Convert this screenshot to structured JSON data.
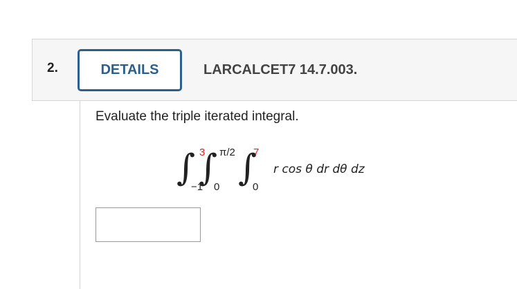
{
  "question": {
    "number": "2.",
    "details_label": "DETAILS",
    "problem_id": "LARCALCET7 14.7.003.",
    "prompt": "Evaluate the triple iterated integral."
  },
  "integral": {
    "outer": {
      "upper": "3",
      "lower": "−1"
    },
    "middle": {
      "upper": "π/2",
      "lower": "0"
    },
    "inner": {
      "upper": "7",
      "lower": "0"
    },
    "integrand": "r cos θ dr dθ dz",
    "highlight_color": "#e0201b"
  },
  "answer": {
    "value": "",
    "placeholder": ""
  }
}
